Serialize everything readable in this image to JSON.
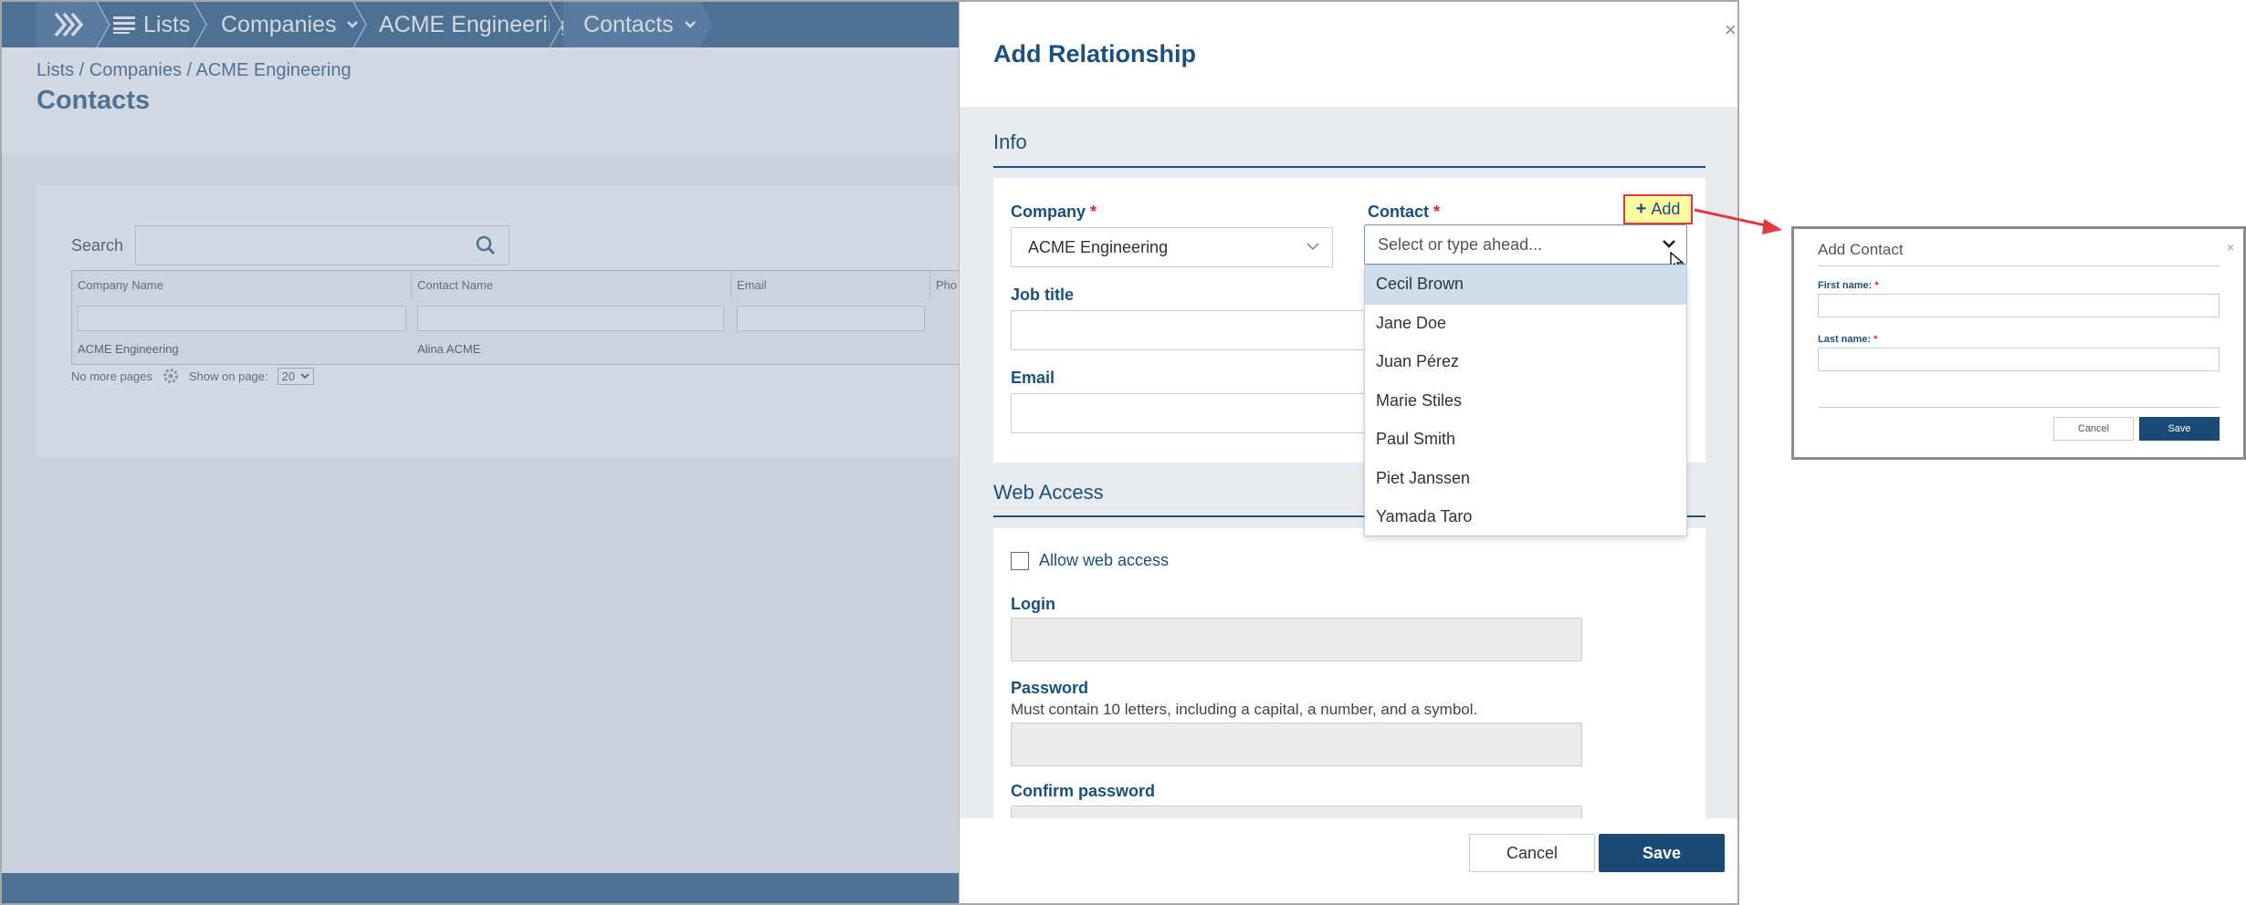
{
  "nav": {
    "home_icon": "chevrons-right-icon",
    "lists_label": "Lists",
    "companies_label": "Companies",
    "company_name": "ACME Engineering",
    "contacts_label": "Contacts"
  },
  "page": {
    "breadcrumb": "Lists / Companies / ACME Engineering",
    "title": "Contacts"
  },
  "grid": {
    "search_label": "Search",
    "columns": [
      "Company Name",
      "Contact Name",
      "Email",
      "Pho"
    ],
    "rows": [
      {
        "company": "ACME Engineering",
        "contact": "Alina ACME",
        "email": ""
      }
    ],
    "footer_pages": "No more pages",
    "footer_show": "Show on page:",
    "page_size": "20"
  },
  "modal": {
    "title": "Add Relationship",
    "info_section": "Info",
    "company_label": "Company",
    "company_value": "ACME Engineering",
    "contact_label": "Contact",
    "contact_placeholder": "Select or type ahead...",
    "add_label": "Add",
    "job_title_label": "Job title",
    "email_label": "Email",
    "web_section": "Web Access",
    "allow_web_label": "Allow web access",
    "login_label": "Login",
    "password_label": "Password",
    "password_hint": "Must contain 10 letters, including a capital, a number, and a symbol.",
    "confirm_label": "Confirm password",
    "cancel_label": "Cancel",
    "save_label": "Save"
  },
  "contact_options": [
    "Cecil Brown",
    "Jane Doe",
    "Juan Pérez",
    "Marie Stiles",
    "Paul Smith",
    "Piet Janssen",
    "Yamada Taro"
  ],
  "add_contact": {
    "title": "Add Contact",
    "first_name_label": "First name:",
    "last_name_label": "Last name:",
    "cancel_label": "Cancel",
    "save_label": "Save"
  },
  "colors": {
    "brand": "#1a4a75",
    "accent_text": "#1b4f7e",
    "required": "#d9262c",
    "highlight": "#fffb9e",
    "callout_arrow": "#e0393e"
  }
}
